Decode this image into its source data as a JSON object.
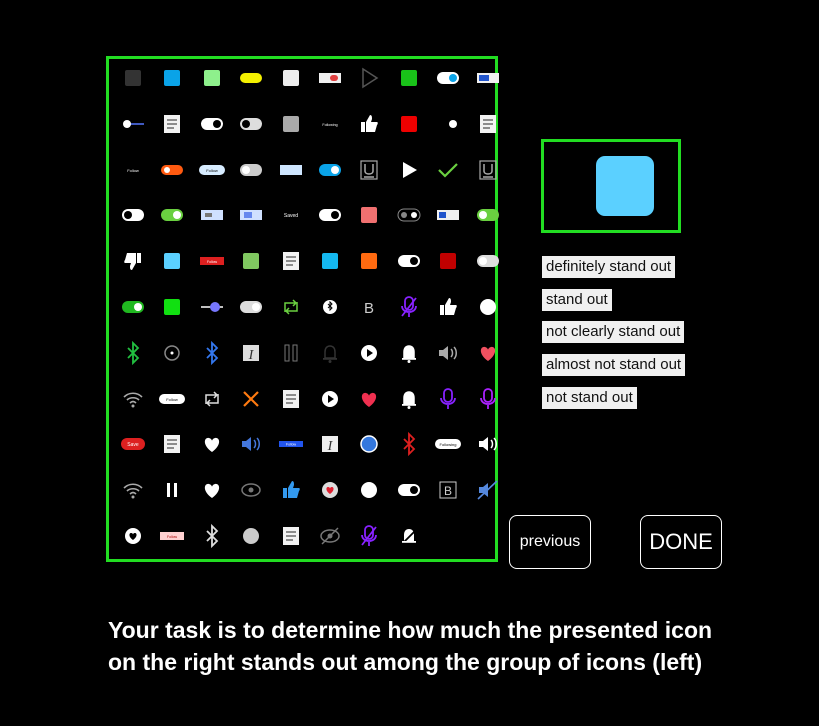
{
  "choices": [
    {
      "label": "definitely stand out"
    },
    {
      "label": "stand out"
    },
    {
      "label": "not clearly stand out"
    },
    {
      "label": "almost not stand out"
    },
    {
      "label": "not stand out"
    }
  ],
  "buttons": {
    "previous": "previous",
    "done": "DONE"
  },
  "instructions": "Your task is to determine how much the presented icon on the right stands out among the group of icons (left)",
  "target_icon": {
    "name": "rounded-square-icon",
    "color": "#5bd0ff"
  },
  "grid_labels": {
    "follow": "Follow",
    "following": "Following",
    "saved": "Saved",
    "save": "Save",
    "b": "B",
    "i": "I"
  },
  "grid_icons": [
    [
      "square-dark",
      "square-blue",
      "square-lightgreen",
      "pill-yellow",
      "square-lightgray",
      "toggle-card",
      "play-outline-icon",
      "square-green",
      "toggle-blue",
      "toggle-blue-rect"
    ],
    [
      "slider-white",
      "document-icon",
      "toggle-white",
      "toggle-white-2",
      "square-gray",
      "following-button",
      "thumbs-up-icon",
      "square-red",
      "toggle-dark",
      "document-icon-2"
    ],
    [
      "follow-text",
      "pill-orange",
      "pill-lightblue",
      "toggle-lightgray",
      "rect-lightblue",
      "toggle-blue-2",
      "underline-icon",
      "play-icon",
      "check-icon",
      "underline-icon-2"
    ],
    [
      "toggle-dark-2",
      "toggle-green",
      "rect-slider",
      "rect-slider-2",
      "saved-text",
      "toggle-white-3",
      "square-pink",
      "toggle-dark-3",
      "rect-blue-white",
      "toggle-green-2"
    ],
    [
      "thumbs-down-icon",
      "square-skyblue",
      "pill-red",
      "square-olivegreen",
      "document-icon-3",
      "square-cyan",
      "square-orange",
      "toggle-white-4",
      "square-darkred",
      "toggle-lightgray-2"
    ],
    [
      "toggle-green-3",
      "square-brightgreen",
      "slider-blue",
      "toggle-gray",
      "repeat-green-icon",
      "bluetooth-dot-icon",
      "bold-icon",
      "mic-off-purple-icon",
      "thumbs-up-icon-2",
      "circle-white"
    ],
    [
      "bluetooth-green-icon",
      "circle-dot-icon",
      "bluetooth-blue-icon",
      "italic-icon",
      "pause-gray-icon",
      "bell-outline-icon",
      "play-circle-icon",
      "bell-icon",
      "volume-icon",
      "heart-red-icon"
    ],
    [
      "wifi-icon",
      "pill-black",
      "repeat-icon",
      "close-orange-icon",
      "document-icon-4",
      "play-circle-2-icon",
      "heart-red-2-icon",
      "bell-2-icon",
      "mic-purple-icon",
      "mic-purple-2-icon"
    ],
    [
      "save-red-button",
      "document-icon-5",
      "heart-white-icon",
      "volume-blue-icon",
      "pill-blue",
      "italic-2-icon",
      "circle-blue",
      "bluetooth-red-icon",
      "following-pill",
      "volume-icon-2"
    ],
    [
      "wifi-2-icon",
      "pause-icon",
      "heart-white-2-icon",
      "eye-icon",
      "thumbs-up-blue-icon",
      "heart-circle-icon",
      "circle-white-2",
      "toggle-white-5",
      "bold-2-icon",
      "volume-muted-icon"
    ],
    [
      "heart-circle-white-icon",
      "pill-pink",
      "bluetooth-white-icon",
      "circle-lightgray",
      "document-icon-6",
      "eye-off-icon",
      "mic-off-purple-2-icon",
      "bell-off-icon"
    ]
  ]
}
